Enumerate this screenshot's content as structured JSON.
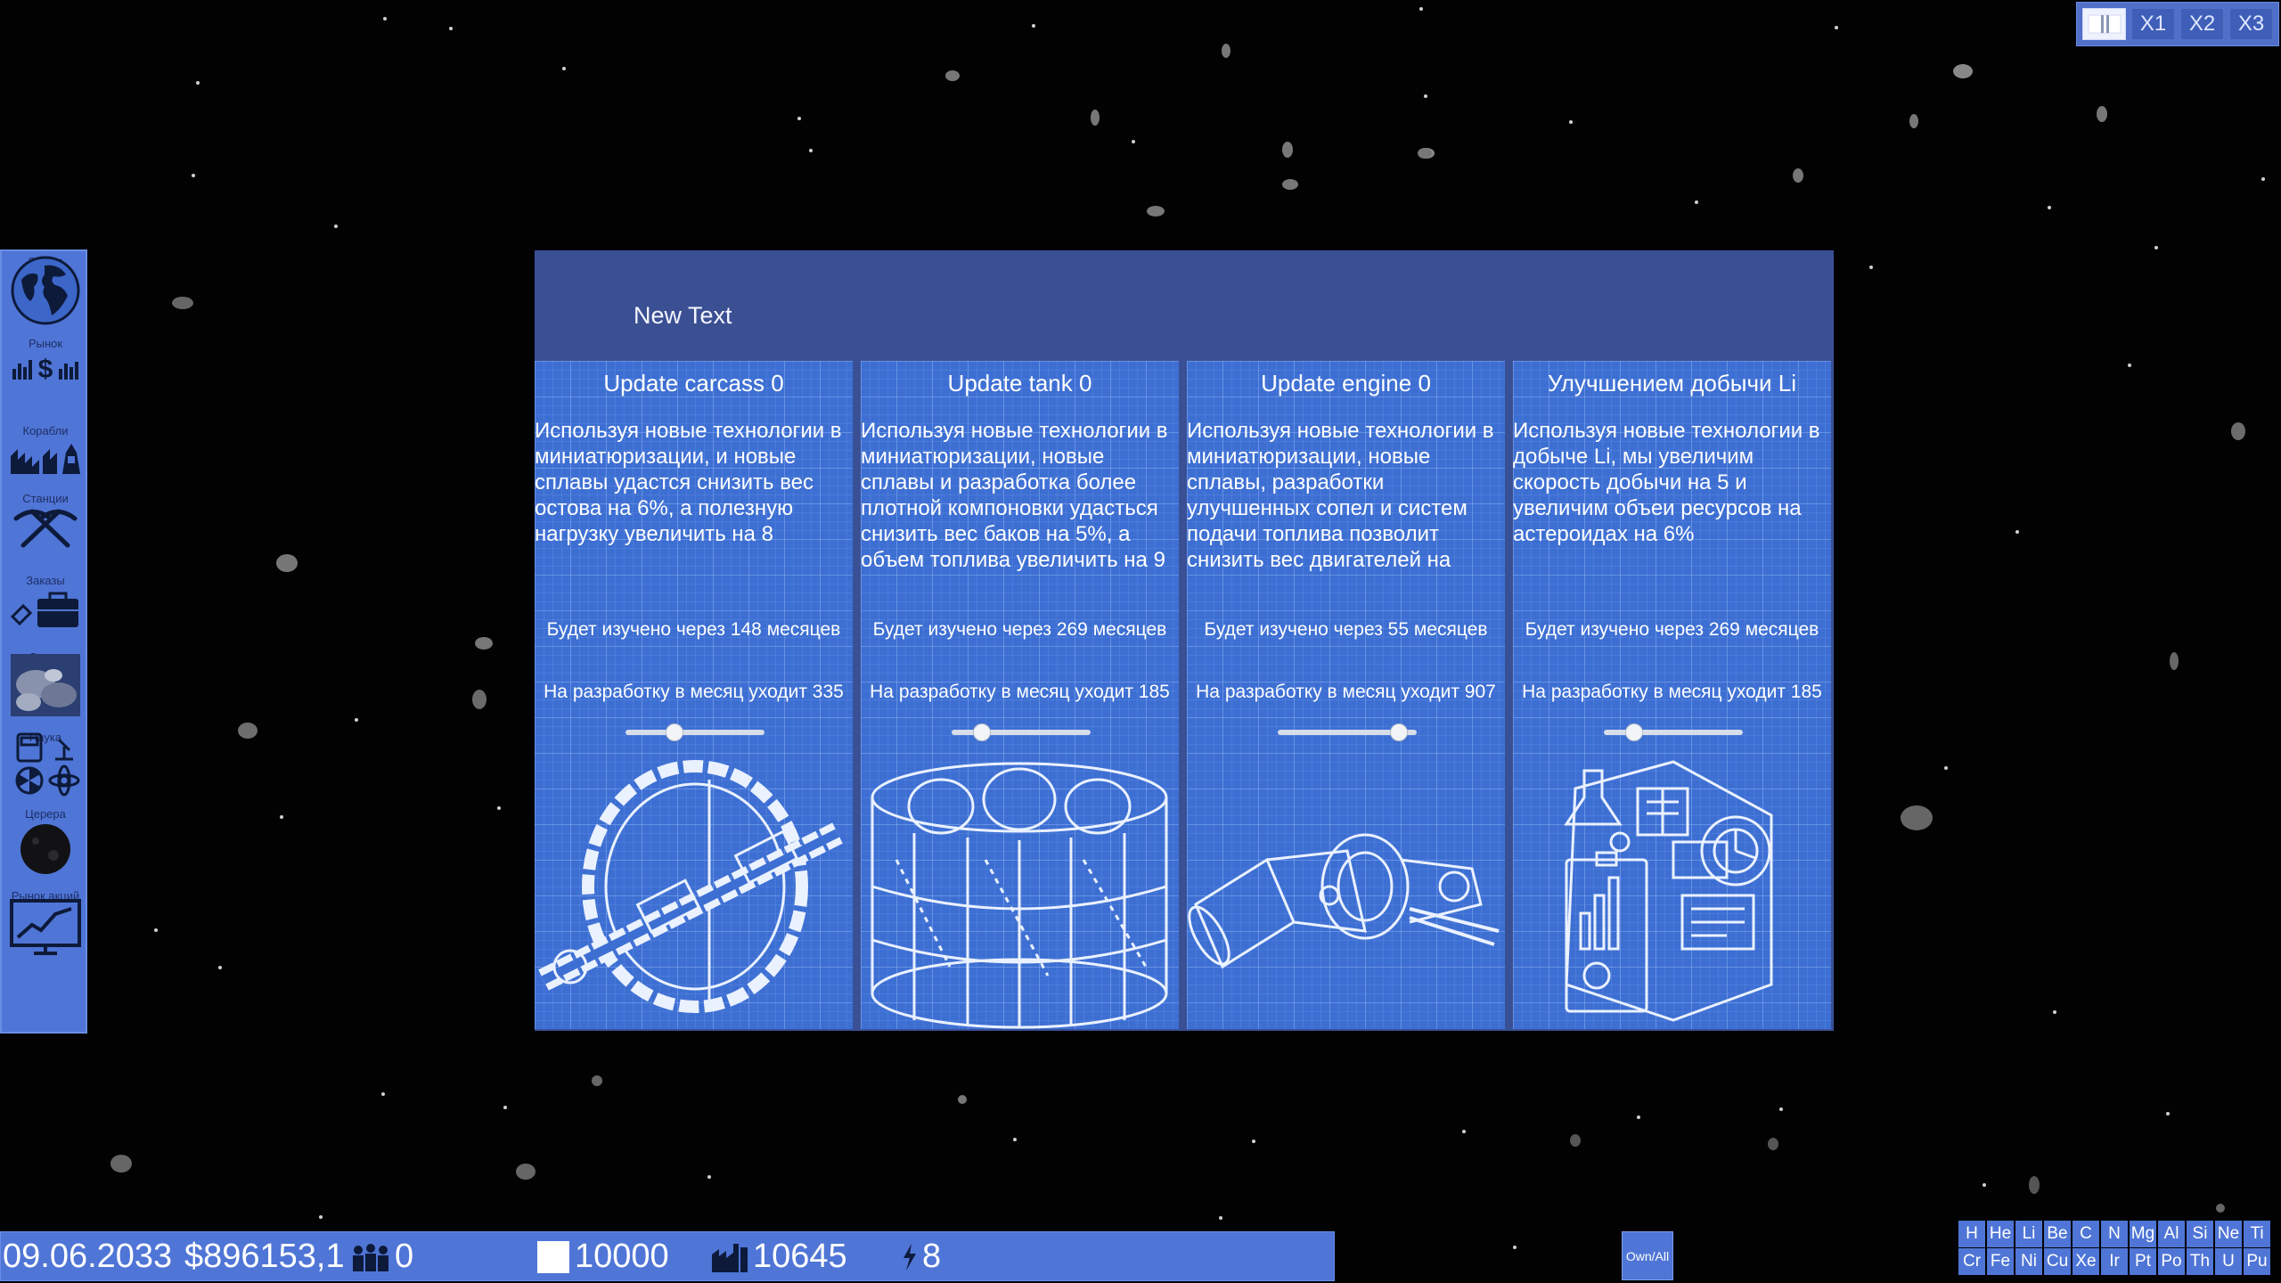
{
  "speed_controls": {
    "pause_icon": "pause-icon",
    "buttons": [
      "X1",
      "X2",
      "X3"
    ]
  },
  "sidebar": {
    "items": [
      {
        "label": "Земля",
        "icon": "earth-globe-icon"
      },
      {
        "label": "Рынок",
        "icon": "market-icon"
      },
      {
        "label": "Корабли",
        "icon": "ships-icon"
      },
      {
        "label": "Станции",
        "icon": "stations-pickaxe-icon"
      },
      {
        "label": "Заказы",
        "icon": "orders-briefcase-icon"
      },
      {
        "label": "Склад",
        "icon": "warehouse-icon"
      },
      {
        "label": "Наука",
        "icon": "science-icon"
      },
      {
        "label": "Церера",
        "icon": "ceres-icon"
      },
      {
        "label": "Рынок акций",
        "icon": "stock-chart-icon"
      }
    ]
  },
  "panel": {
    "title": "New Text",
    "cards": [
      {
        "title": "Update carcass 0",
        "description": "Используя новые технологии в миниатюризации, и новые сплавы удастся снизить вес остова на 6%, а полезную нагрузку увеличить на 8",
        "time": "Будет изучено через 148 месяцев",
        "cost": "На разработку в месяц уходит 335",
        "slider_value": 0.35,
        "art": "space-station-blueprint"
      },
      {
        "title": "Update tank 0",
        "description": "Используя новые технологии в миниатюризации, новые сплавы и разработка более плотной компоновки удасться снизить вес баков на 5%, а объем топлива увеличить на 9",
        "time": "Будет изучено через 269 месяцев",
        "cost": "На разработку в месяц уходит 185",
        "slider_value": 0.22,
        "art": "fuel-tank-blueprint"
      },
      {
        "title": "Update engine 0",
        "description": "Используя новые технологии в миниатюризации, новые сплавы, разработки улучшенных сопел и систем подачи топлива позволит снизить вес двигателей на",
        "time": "Будет изучено через 55 месяцев",
        "cost": "На разработку в месяц уходит 907",
        "slider_value": 0.87,
        "art": "engine-blueprint"
      },
      {
        "title": "Улучшением добычи Li",
        "description": "Используя новые технологии в добыче Li, мы увеличим скорость добычи на 5 и увеличим объеи ресурсов на астероидах на 6%",
        "time": "Будет изучено через 269 месяцев",
        "cost": "На разработку в месяц уходит 185",
        "slider_value": 0.22,
        "art": "research-lab-blueprint"
      }
    ]
  },
  "statusbar": {
    "date": "09.06.2033",
    "money": "$896153,1",
    "people": "0",
    "storage": "10000",
    "factories": "10645",
    "energy": "8"
  },
  "own_all_label": "Own/All",
  "elements": {
    "row1": [
      "H",
      "He",
      "Li",
      "Be",
      "C",
      "N",
      "Mg",
      "Al",
      "Si",
      "Ne",
      "Ti"
    ],
    "row2": [
      "Cr",
      "Fe",
      "Ni",
      "Cu",
      "Xe",
      "Ir",
      "Pt",
      "Po",
      "Th",
      "U",
      "Pu"
    ]
  }
}
